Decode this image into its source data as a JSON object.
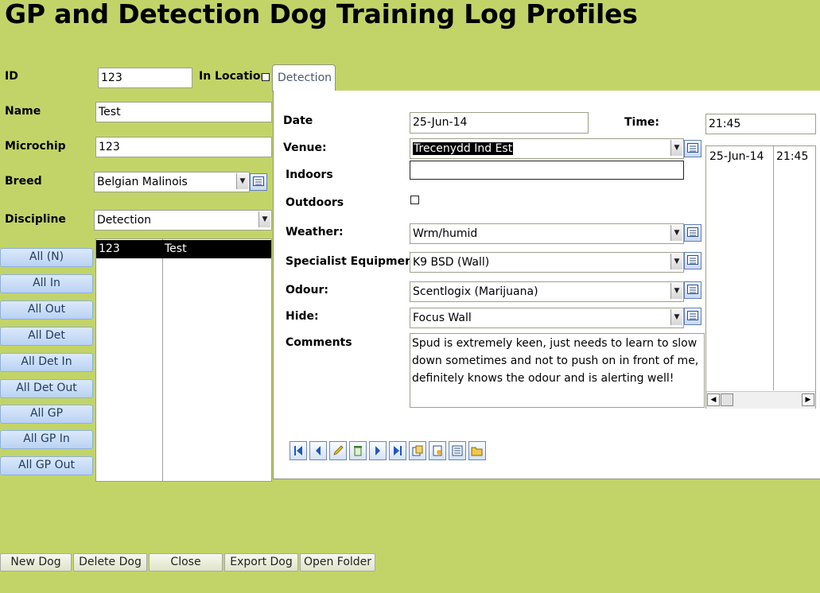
{
  "title": "GP and Detection Dog Training Log Profiles",
  "left_form": {
    "id_label": "ID",
    "id_value": "123",
    "in_location_label": "In Location",
    "name_label": "Name",
    "name_value": "Test",
    "microchip_label": "Microchip",
    "microchip_value": "123",
    "breed_label": "Breed",
    "breed_value": "Belgian Malinois",
    "discipline_label": "Discipline",
    "discipline_value": "Detection"
  },
  "filter_buttons": [
    "All (N)",
    "All In",
    "All Out",
    "All Det",
    "All Det In",
    "All Det Out",
    "All GP",
    "All GP In",
    "All GP Out"
  ],
  "dog_list": {
    "rows": [
      {
        "id": "123",
        "name": "Test"
      }
    ]
  },
  "tab": {
    "label": "Detection"
  },
  "detection_form": {
    "date_label": "Date",
    "date_value": "25-Jun-14",
    "time_label": "Time:",
    "time_value": "21:45",
    "venue_label": "Venue:",
    "venue_value": "Trecenydd Ind Est",
    "indoors_label": "Indoors",
    "indoors_value": "",
    "outdoors_label": "Outdoors",
    "weather_label": "Weather:",
    "weather_value": "Wrm/humid",
    "equipment_label": "Specialist Equipment:",
    "equipment_value": "K9 BSD (Wall)",
    "odour_label": "Odour:",
    "odour_value": "Scentlogix (Marijuana)",
    "hide_label": "Hide:",
    "hide_value": "Focus Wall",
    "comments_label": "Comments",
    "comments_value": "Spud is extremely keen, just needs to learn to slow down sometimes and not to push on in front of me, definitely knows the odour and is alerting well!"
  },
  "session_list": {
    "rows": [
      {
        "date": "25-Jun-14",
        "time": "21:45"
      }
    ]
  },
  "record_toolbar": [
    "first-record-icon",
    "previous-record-icon",
    "edit-record-icon",
    "delete-record-icon",
    "next-record-icon",
    "last-record-icon",
    "new-record-icon",
    "report-icon",
    "list-icon",
    "open-folder-icon"
  ],
  "bottom_buttons": [
    "New Dog",
    "Delete Dog",
    "Close",
    "Export Dog",
    "Open Folder"
  ],
  "colors": {
    "background": "#c2d468",
    "selection": "#000000",
    "button_blue": "#c9dcf5"
  }
}
